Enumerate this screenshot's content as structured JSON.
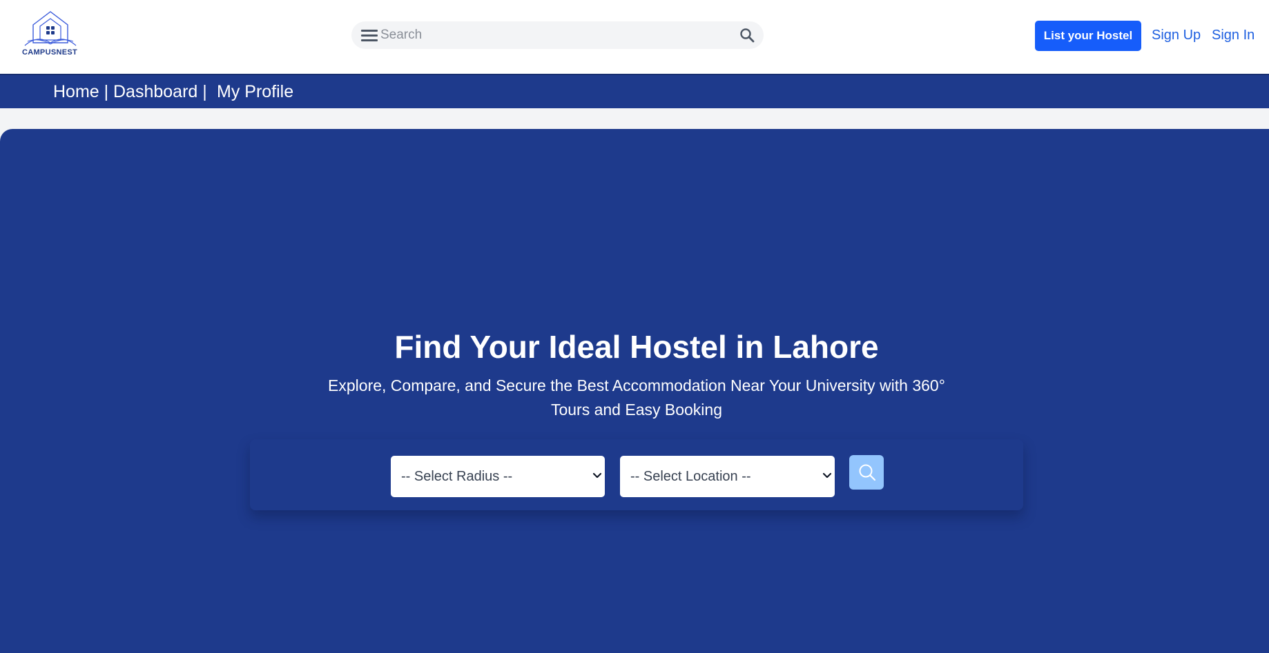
{
  "brand": {
    "name": "CAMPUSNEST"
  },
  "header": {
    "search_placeholder": "Search",
    "list_button": "List your Hostel",
    "signup": "Sign Up",
    "signin": "Sign In"
  },
  "nav": {
    "home": "Home |",
    "dashboard": "Dashboard |",
    "profile": "My Profile"
  },
  "hero": {
    "title": "Find Your Ideal Hostel in Lahore",
    "subtitle": "Explore, Compare, and Secure the Best Accommodation Near Your University with 360° Tours and Easy Booking",
    "radius_select": "-- Select Radius --",
    "location_select": "-- Select Location --"
  },
  "colors": {
    "primary_navy": "#1e3a8c",
    "button_blue": "#165dfa",
    "link_blue": "#1d5fe0",
    "search_button_light_blue": "#93c5fd"
  },
  "icons": [
    "logo-house-icon",
    "menu-icon",
    "search-icon",
    "chevron-down-icon"
  ]
}
